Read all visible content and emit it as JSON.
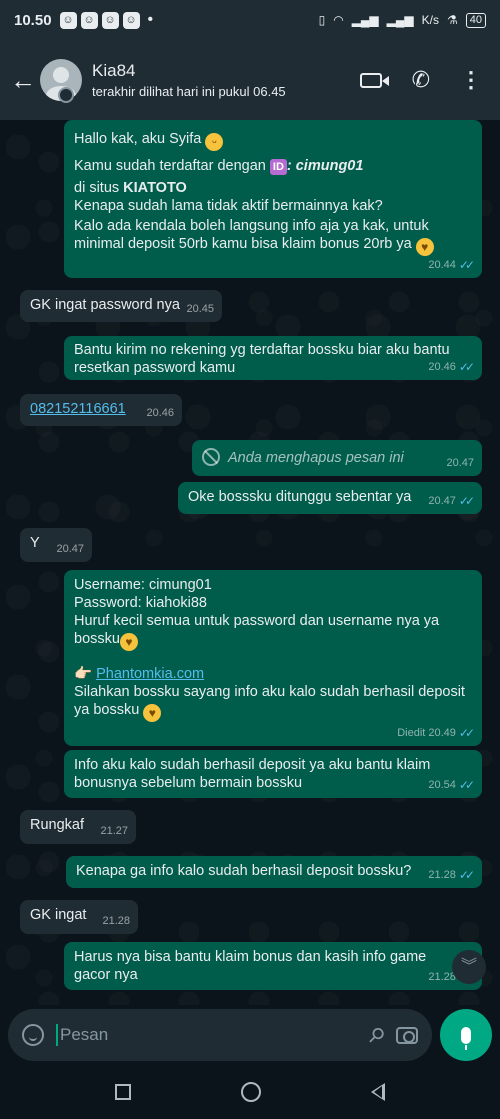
{
  "status_bar": {
    "time": "10.50",
    "dot": "•",
    "network_speed": "K/s",
    "battery": "40"
  },
  "header": {
    "contact_name": "Kia84",
    "last_seen": "terakhir dilihat hari ini pukul 06.45"
  },
  "messages": [
    {
      "direction": "out",
      "greeting": "Hallo kak, aku Syifa",
      "registered_prefix": "Kamu sudah terdaftar dengan",
      "id_badge": "ID",
      "username_text": ": cimung01",
      "site_prefix": "di situs",
      "site_name": "KIATOTO",
      "line3": "Kenapa sudah lama tidak aktif bermainnya kak?",
      "line4": "Kalo ada kendala boleh langsung info aja ya kak, untuk minimal deposit 50rb kamu bisa klaim bonus 20rb ya",
      "time": "20.44"
    },
    {
      "direction": "in",
      "text": "GK ingat password nya",
      "time": "20.45"
    },
    {
      "direction": "out",
      "text": "Bantu kirim no rekening yg terdaftar bossku biar aku bantu resetkan password kamu",
      "time": "20.46"
    },
    {
      "direction": "in",
      "text": "082152116661",
      "time": "20.46"
    },
    {
      "direction": "out",
      "text": "Anda menghapus pesan ini",
      "time": "20.47",
      "deleted": true
    },
    {
      "direction": "out",
      "text": "Oke bosssku ditunggu sebentar ya",
      "time": "20.47"
    },
    {
      "direction": "in",
      "text": "Y",
      "time": "20.47"
    },
    {
      "direction": "out",
      "username_line": "Username: cimung01",
      "password_line": "Password: kiahoki88",
      "note_line": "Huruf kecil semua untuk password dan username nya ya bossku",
      "pointer": "👉🏻",
      "link": "Phantomkia.com",
      "info_line": "Silahkan bossku sayang info aku kalo sudah berhasil deposit ya bossku",
      "edited_label": "Diedit",
      "time": "20.49"
    },
    {
      "direction": "out",
      "text": "Info aku kalo sudah berhasil deposit ya aku bantu klaim bonusnya sebelum bermain bossku",
      "time": "20.54"
    },
    {
      "direction": "in",
      "text": "Rungkaf",
      "time": "21.27"
    },
    {
      "direction": "out",
      "text": "Kenapa ga info kalo sudah berhasil deposit bossku?",
      "time": "21.28"
    },
    {
      "direction": "in",
      "text": "GK ingat",
      "time": "21.28"
    },
    {
      "direction": "out",
      "text": "Harus nya bisa bantu klaim bonus dan kasih info game gacor nya",
      "time": "21.28"
    }
  ],
  "composer": {
    "placeholder": "Pesan"
  },
  "colors": {
    "outgoing_bubble": "#005c4b",
    "incoming_bubble": "#202c33",
    "accent": "#00a884",
    "read_ticks": "#53bdeb"
  }
}
